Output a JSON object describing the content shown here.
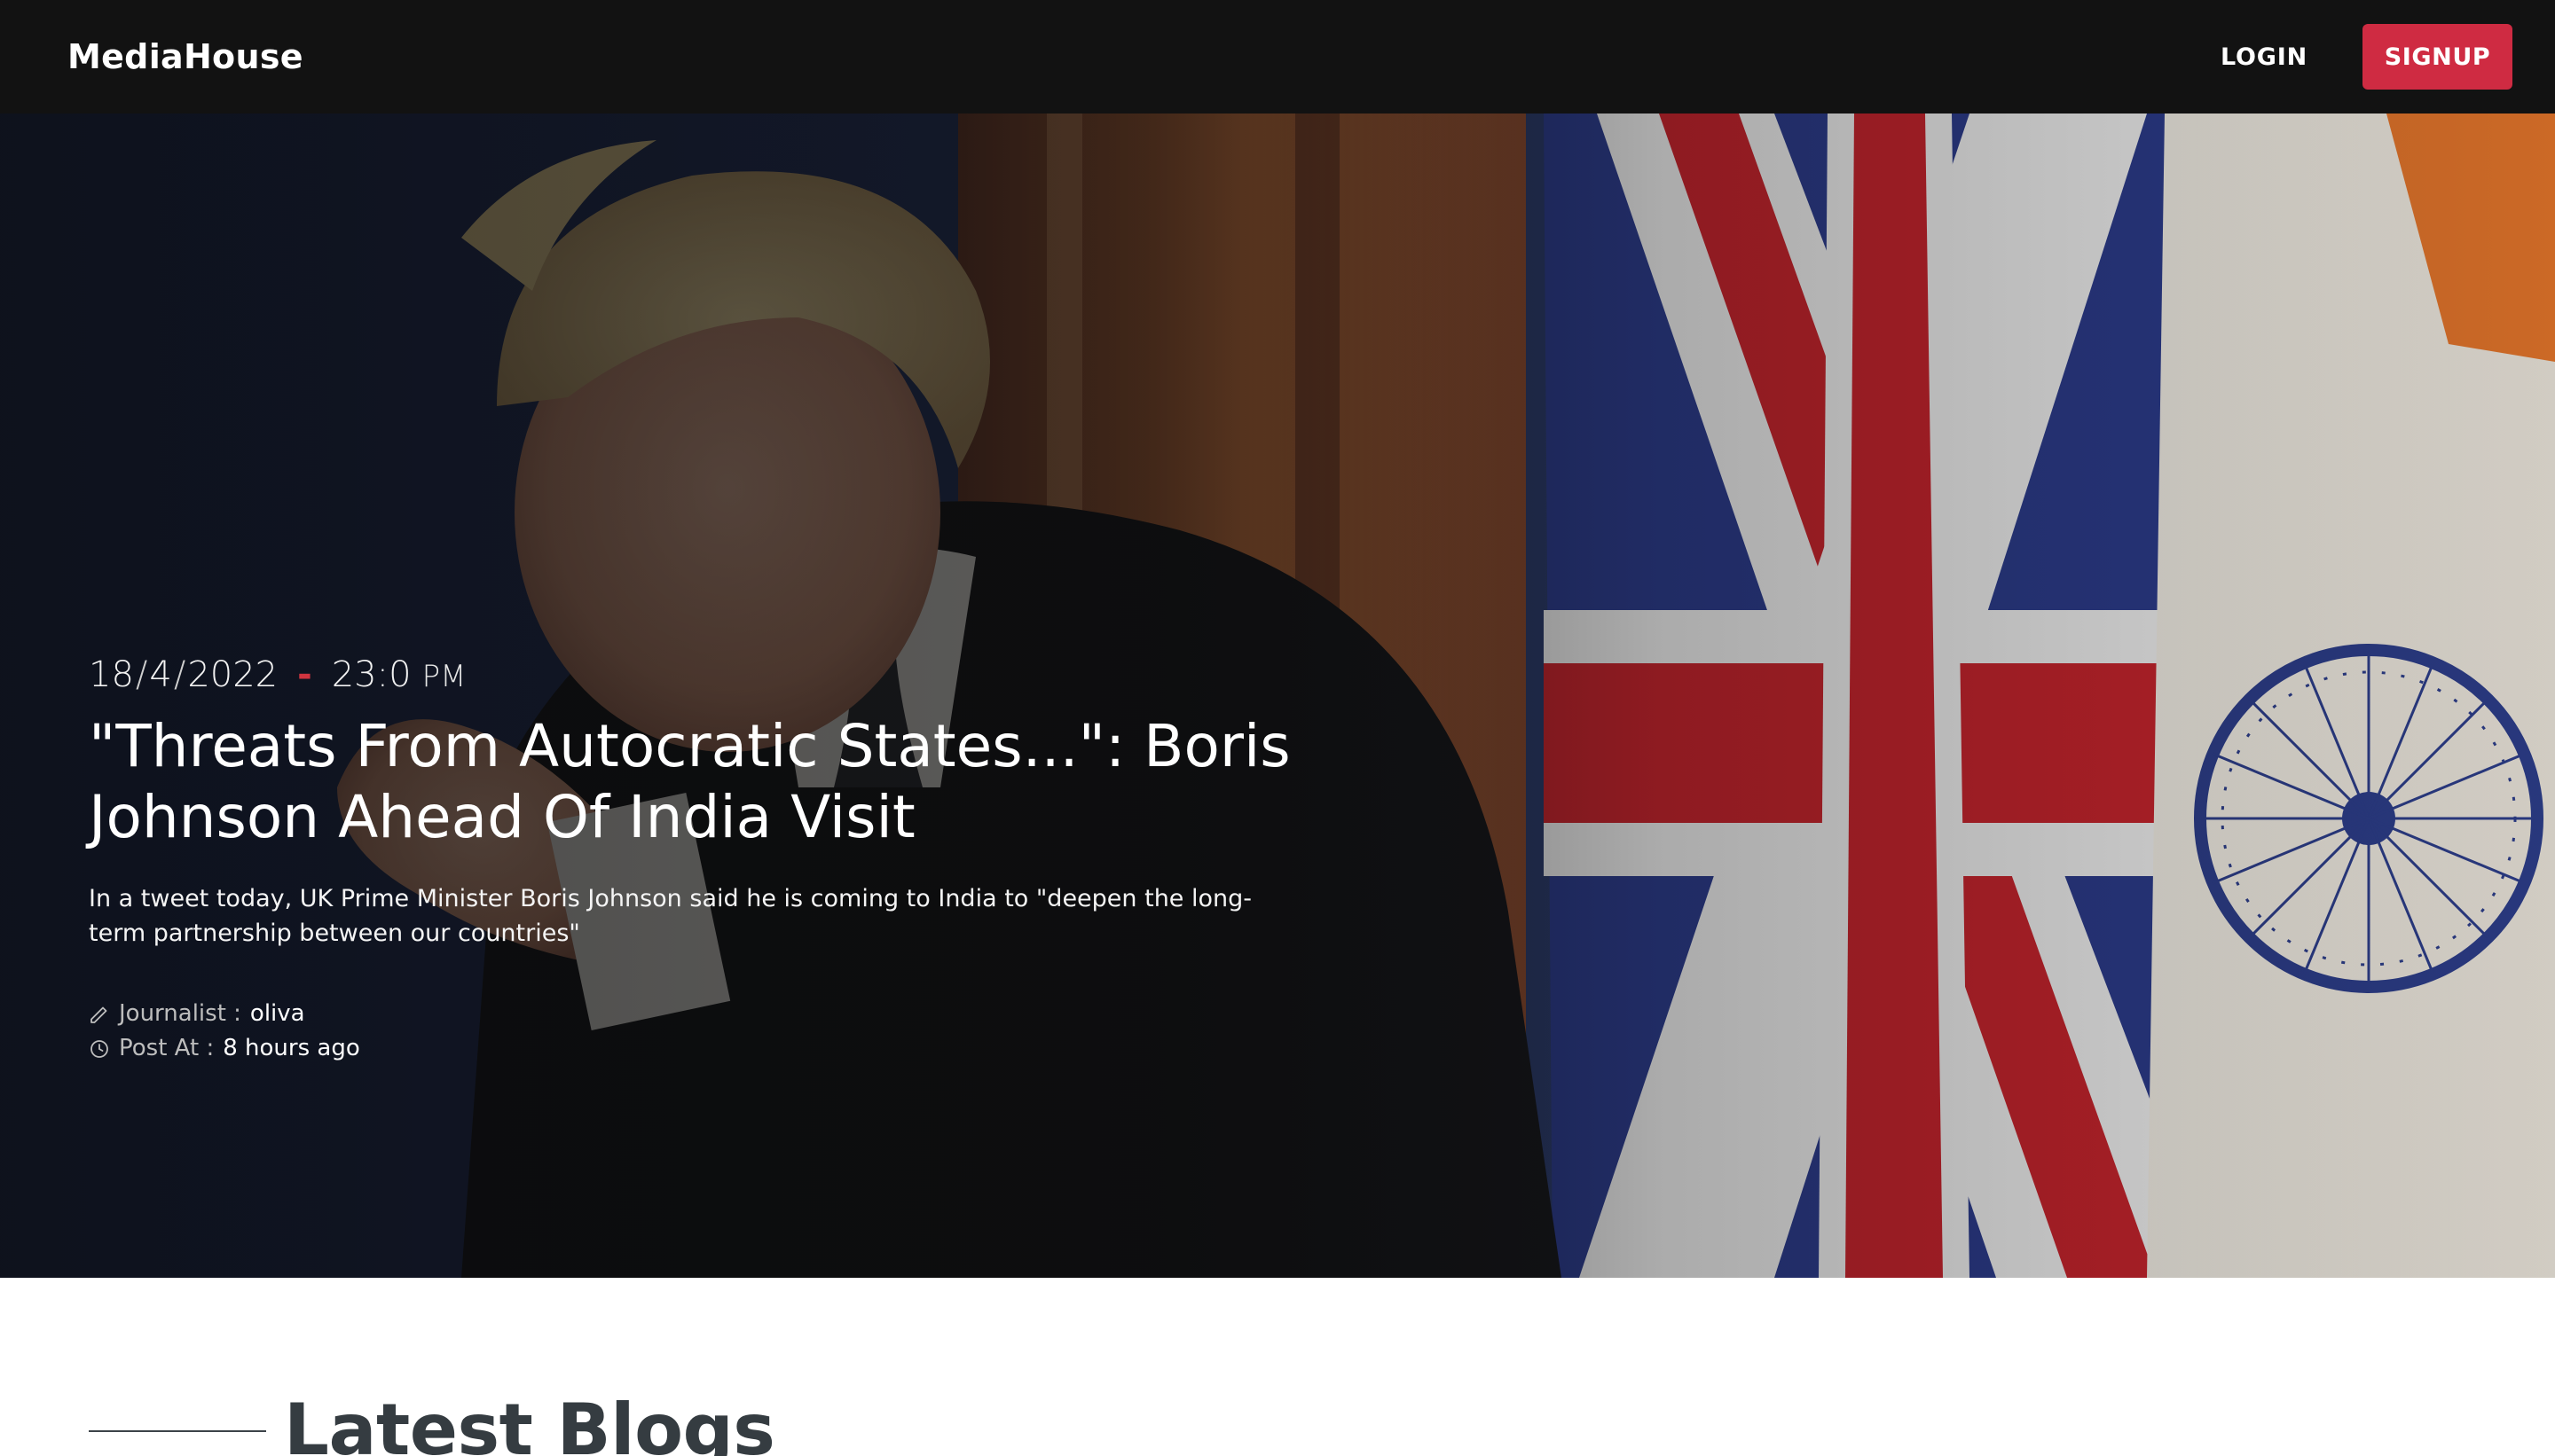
{
  "nav": {
    "brand": "MediaHouse",
    "login_label": "LOGIN",
    "signup_label": "SIGNUP"
  },
  "hero": {
    "date": {
      "day": "18",
      "month": "4",
      "year": "2022",
      "time": "23:0",
      "ampm": "PM"
    },
    "headline": "\"Threats From Autocratic States...\": Boris Johnson Ahead Of India Visit",
    "summary": "In a tweet today, UK Prime Minister Boris Johnson said he is coming to India to \"deepen the long-term partnership between our countries\"",
    "journalist_label": "Journalist :",
    "journalist_name": "oliva",
    "posted_label": "Post At :",
    "posted_value": "8 hours ago",
    "icons": [
      "pencil-icon",
      "clock-icon"
    ]
  },
  "latest": {
    "title": "Latest Blogs"
  },
  "colors": {
    "nav_bg": "#121212",
    "accent": "#cf2b42",
    "heading_dark": "#353c41"
  }
}
